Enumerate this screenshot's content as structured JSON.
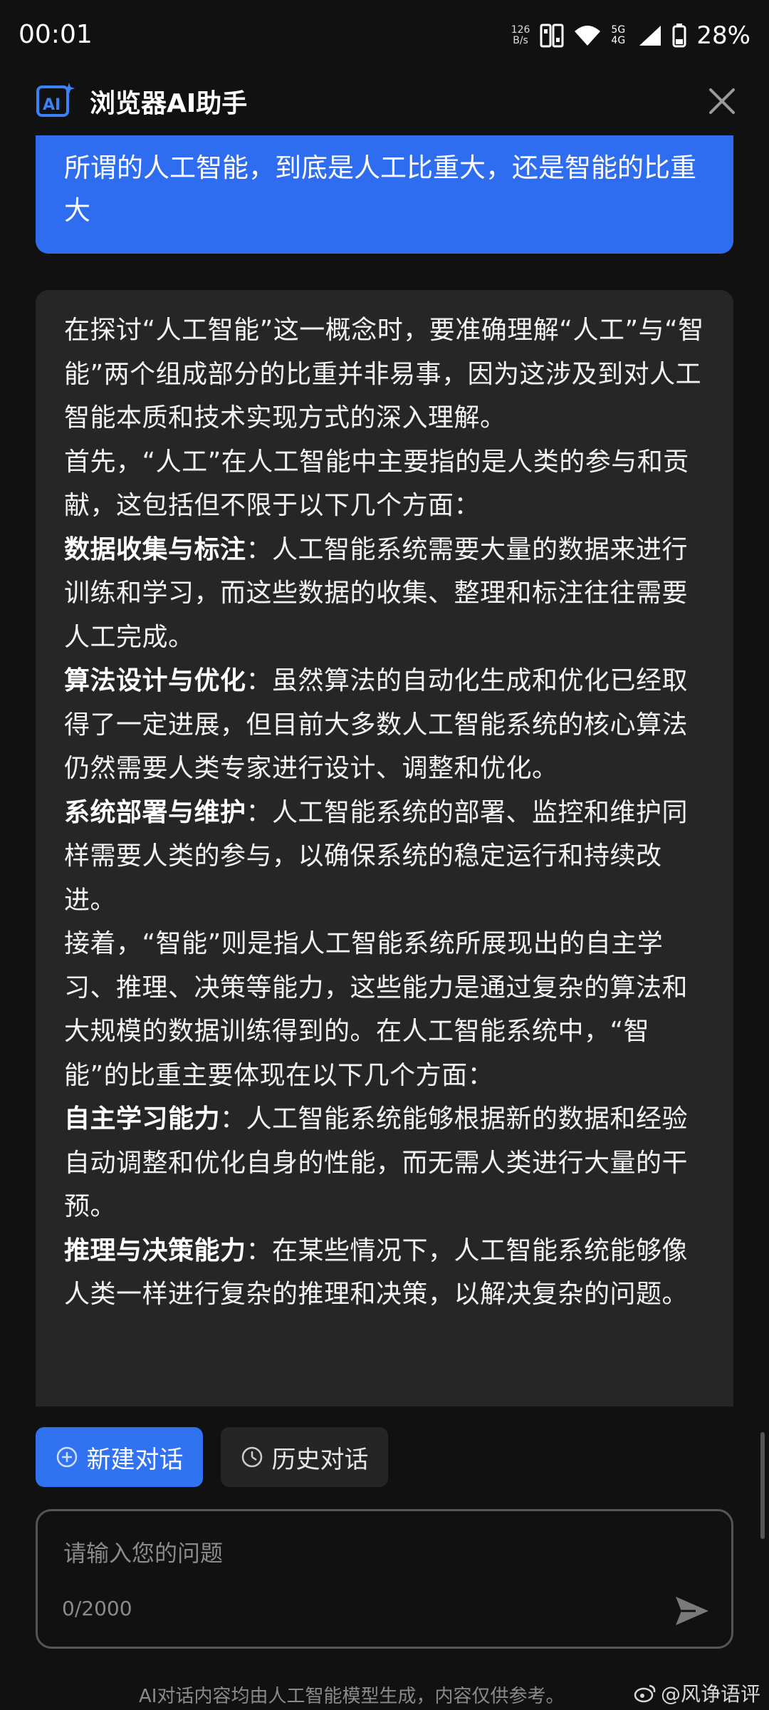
{
  "status_bar": {
    "time": "00:01",
    "net_speed_value": "126",
    "net_speed_unit": "B/s",
    "network": "5G 4G",
    "battery": "28%"
  },
  "header": {
    "logo_text": "AI",
    "title": "浏览器AI助手"
  },
  "user_message": "所谓的人工智能，到底是人工比重大，还是智能的比重大",
  "ai_response": {
    "p1": "在探讨“人工智能”这一概念时，要准确理解“人工”与“智能”两个组成部分的比重并非易事，因为这涉及到对人工智能本质和技术实现方式的深入理解。",
    "p2": "首先，“人工”在人工智能中主要指的是人类的参与和贡献，这包括但不限于以下几个方面：",
    "p3_bold": "数据收集与标注",
    "p3_text": "：人工智能系统需要大量的数据来进行训练和学习，而这些数据的收集、整理和标注往往需要人工完成。",
    "p4_bold": "算法设计与优化",
    "p4_text": "：虽然算法的自动化生成和优化已经取得了一定进展，但目前大多数人工智能系统的核心算法仍然需要人类专家进行设计、调整和优化。",
    "p5_bold": "系统部署与维护",
    "p5_text": "：人工智能系统的部署、监控和维护同样需要人类的参与，以确保系统的稳定运行和持续改进。",
    "p6": "接着，“智能”则是指人工智能系统所展现出的自主学习、推理、决策等能力，这些能力是通过复杂的算法和大规模的数据训练得到的。在人工智能系统中，“智能”的比重主要体现在以下几个方面：",
    "p7_bold": "自主学习能力",
    "p7_text": "：人工智能系统能够根据新的数据和经验自动调整和优化自身的性能，而无需人类进行大量的干预。",
    "p8_bold": "推理与决策能力",
    "p8_text": "：在某些情况下，人工智能系统能够像人类一样进行复杂的推理和决策，以解决复杂的问题。"
  },
  "actions": {
    "new_chat": "新建对话",
    "history": "历史对话"
  },
  "input": {
    "placeholder": "请输入您的问题",
    "char_count": "0/2000"
  },
  "disclaimer": "AI对话内容均由人工智能模型生成，内容仅供参考。",
  "watermark": "@风诤语评",
  "colors": {
    "accent": "#2f6df0",
    "background": "#111111",
    "card": "#262626"
  }
}
